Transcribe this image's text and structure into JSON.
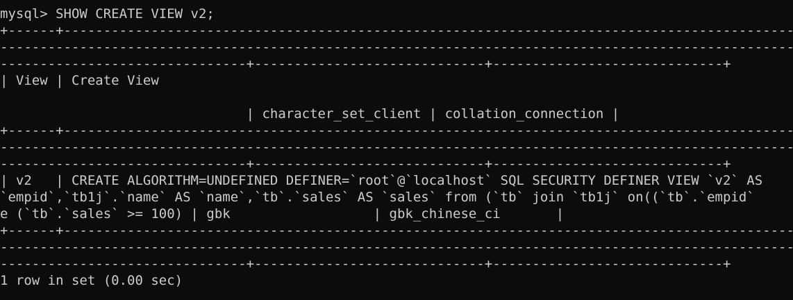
{
  "terminal": {
    "prompt_line": "mysql> SHOW CREATE VIEW v2;",
    "sep1": "+------+---------------------------------------------------------------------------------------------------------------------------------------------",
    "sep2": "----------------------------------------------------------------------------------------------------------------------------------------------------",
    "sep3": "-------------------------------+-----------------------------+-----------------------------+",
    "header_line1": "| View | Create View",
    "header_line2": "                               | character_set_client | collation_connection |",
    "sep4": "+------+---------------------------------------------------------------------------------------------------------------------------------------------",
    "sep5": "----------------------------------------------------------------------------------------------------------------------------------------------------",
    "sep6": "-------------------------------+-----------------------------+-----------------------------+",
    "row_line1": "| v2   | CREATE ALGORITHM=UNDEFINED DEFINER=`root`@`localhost` SQL SECURITY DEFINER VIEW `v2` AS",
    "row_line2": "`empid`,`tb1j`.`name` AS `name`,`tb`.`sales` AS `sales` from (`tb` join `tb1j` on((`tb`.`empid`",
    "row_line3": "e (`tb`.`sales` >= 100) | gbk                  | gbk_chinese_ci       |",
    "sep7": "+------+---------------------------------------------------------------------------------------------------------------------------------------------",
    "sep8": "----------------------------------------------------------------------------------------------------------------------------------------------------",
    "sep9": "-------------------------------+-----------------------------+-----------------------------+",
    "result_line": "1 row in set (0.00 sec)"
  }
}
